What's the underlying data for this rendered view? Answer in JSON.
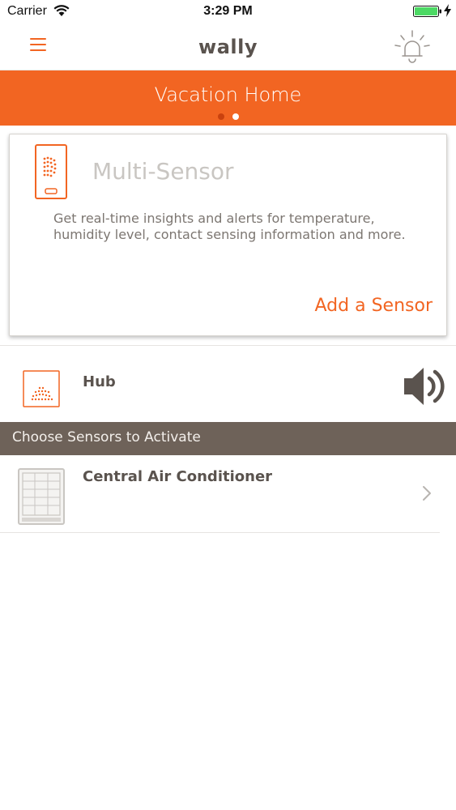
{
  "status_bar": {
    "carrier": "Carrier",
    "time": "3:29 PM",
    "battery_color": "#4cd964",
    "icons": [
      "wifi-icon",
      "battery-icon",
      "charging-bolt-icon"
    ]
  },
  "nav": {
    "title": "wally",
    "menu_icon": "hamburger-menu-icon",
    "alarm_icon": "alarm-bell-icon"
  },
  "location": {
    "name": "Vacation Home",
    "pages_total": 2,
    "current_page": 1
  },
  "sensor_card": {
    "icon": "multi-sensor-device-icon",
    "title": "Multi-Sensor",
    "description": "Get real-time insights and alerts for temperature, humidity level, contact sensing information and more.",
    "action_label": "Add a Sensor"
  },
  "hub": {
    "icon": "hub-device-icon",
    "label": "Hub",
    "speaker_icon": "speaker-volume-icon"
  },
  "sensors_section": {
    "title": "Choose Sensors to Activate",
    "items": [
      {
        "label": "Central Air Conditioner",
        "icon": "air-conditioner-icon"
      }
    ]
  },
  "colors": {
    "accent": "#f26522",
    "section_header": "#6e6259",
    "text": "#5a534e",
    "card_title": "#c9c6c2"
  }
}
